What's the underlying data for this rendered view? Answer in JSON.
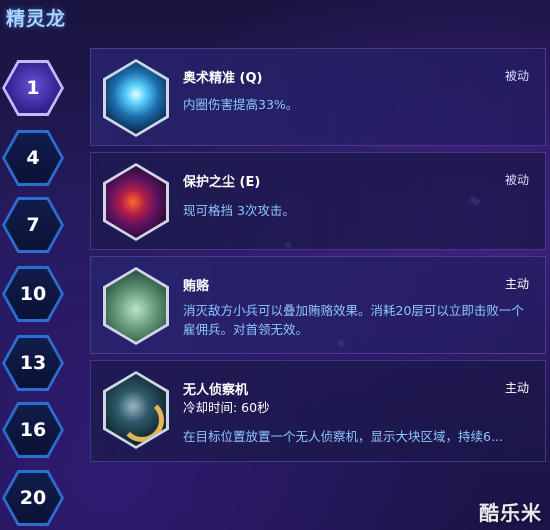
{
  "hero_name": "精灵龙",
  "levels": [
    "1",
    "4",
    "7",
    "10",
    "13",
    "16",
    "20"
  ],
  "active_level": "1",
  "talents": [
    {
      "name": "奥术精准 (Q)",
      "tag": "被动",
      "desc": "内圈伤害提高33%。",
      "icon": "arcane-precision-icon"
    },
    {
      "name": "保护之尘 (E)",
      "tag": "被动",
      "desc": "现可格挡 3次攻击。",
      "icon": "shield-dust-icon"
    },
    {
      "name": "贿赂",
      "tag": "主动",
      "desc": "消灭敌方小兵可以叠加贿赂效果。消耗20层可以立即击败一个雇佣兵。对首领无效。",
      "icon": "bribe-icon"
    },
    {
      "name": "无人侦察机",
      "tag": "主动",
      "cooldown": "冷却时间: 60秒",
      "desc": "在目标位置放置一个无人侦察机，显示大块区域，持续6...",
      "icon": "scouting-drone-icon"
    }
  ],
  "watermark": "酷乐米",
  "colors": {
    "accent_blue": "#8ec6ff",
    "hex_border": "#2a6fd1",
    "active_hex": "#6a4fd6"
  }
}
